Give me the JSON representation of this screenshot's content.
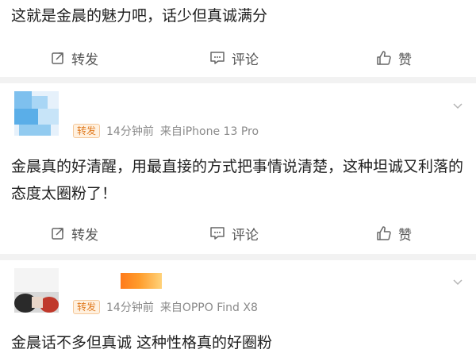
{
  "post": {
    "text": "这就是金晨的魅力吧，话少但真诚满分",
    "actions": {
      "repost": "转发",
      "comment": "评论",
      "like": "赞"
    }
  },
  "comments": [
    {
      "badge": "转发",
      "time": "14分钟前",
      "source": "来自iPhone 13 Pro",
      "text": "金晨真的好清醒，用最直接的方式把事情说清楚，这种坦诚又利落的态度太圈粉了！",
      "actions": {
        "repost": "转发",
        "comment": "评论",
        "like": "赞"
      }
    },
    {
      "badge": "转发",
      "time": "14分钟前",
      "source": "来自OPPO Find X8",
      "text": "金晨话不多但真诚 这种性格真的好圈粉"
    }
  ],
  "colors": {
    "accent": "#e07a20",
    "source_link": "#2a6fb8"
  }
}
